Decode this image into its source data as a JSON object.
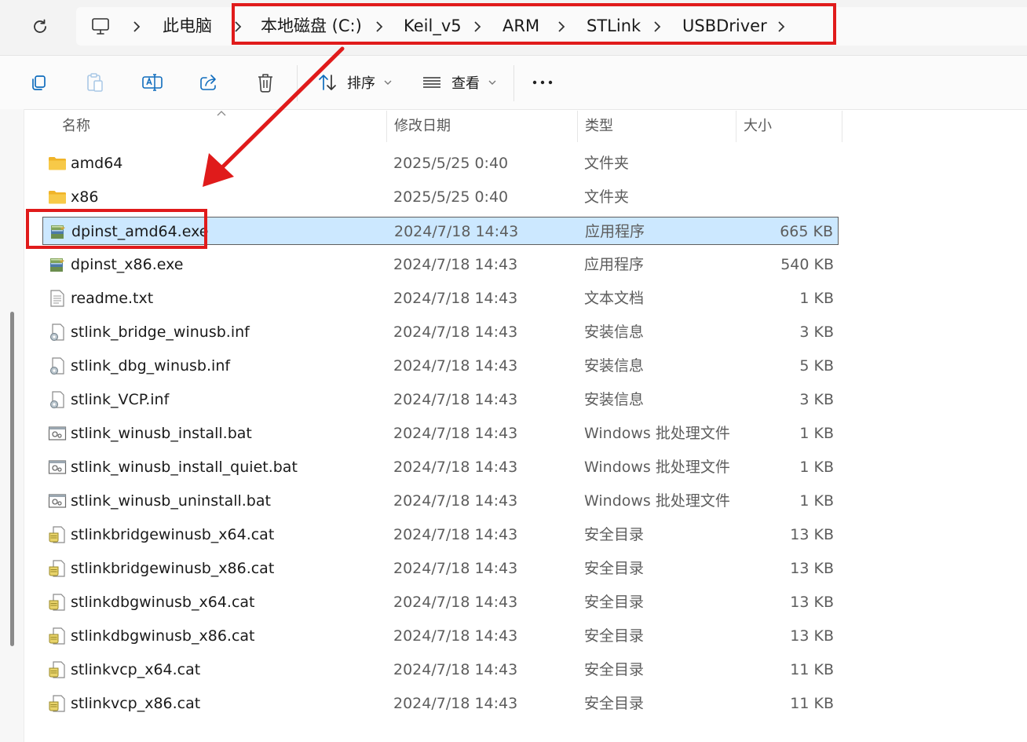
{
  "address": {
    "crumbs": [
      "此电脑",
      "本地磁盘 (C:)",
      "Keil_v5",
      "ARM",
      "STLink",
      "USBDriver"
    ]
  },
  "toolbar": {
    "sort_label": "排序",
    "view_label": "查看"
  },
  "columns": {
    "name": "名称",
    "date": "修改日期",
    "type": "类型",
    "size": "大小"
  },
  "files": [
    {
      "name": "amd64",
      "date": "2025/5/25 0:40",
      "type": "文件夹",
      "size": "",
      "icon": "folder-icon"
    },
    {
      "name": "x86",
      "date": "2025/5/25 0:40",
      "type": "文件夹",
      "size": "",
      "icon": "folder-icon"
    },
    {
      "name": "dpinst_amd64.exe",
      "date": "2024/7/18 14:43",
      "type": "应用程序",
      "size": "665 KB",
      "icon": "installer-icon",
      "selected": true
    },
    {
      "name": "dpinst_x86.exe",
      "date": "2024/7/18 14:43",
      "type": "应用程序",
      "size": "540 KB",
      "icon": "installer-icon"
    },
    {
      "name": "readme.txt",
      "date": "2024/7/18 14:43",
      "type": "文本文档",
      "size": "1 KB",
      "icon": "text-file-icon"
    },
    {
      "name": "stlink_bridge_winusb.inf",
      "date": "2024/7/18 14:43",
      "type": "安装信息",
      "size": "3 KB",
      "icon": "setup-info-icon"
    },
    {
      "name": "stlink_dbg_winusb.inf",
      "date": "2024/7/18 14:43",
      "type": "安装信息",
      "size": "5 KB",
      "icon": "setup-info-icon"
    },
    {
      "name": "stlink_VCP.inf",
      "date": "2024/7/18 14:43",
      "type": "安装信息",
      "size": "3 KB",
      "icon": "setup-info-icon"
    },
    {
      "name": "stlink_winusb_install.bat",
      "date": "2024/7/18 14:43",
      "type": "Windows 批处理文件",
      "size": "1 KB",
      "icon": "batch-file-icon"
    },
    {
      "name": "stlink_winusb_install_quiet.bat",
      "date": "2024/7/18 14:43",
      "type": "Windows 批处理文件",
      "size": "1 KB",
      "icon": "batch-file-icon"
    },
    {
      "name": "stlink_winusb_uninstall.bat",
      "date": "2024/7/18 14:43",
      "type": "Windows 批处理文件",
      "size": "1 KB",
      "icon": "batch-file-icon"
    },
    {
      "name": "stlinkbridgewinusb_x64.cat",
      "date": "2024/7/18 14:43",
      "type": "安全目录",
      "size": "13 KB",
      "icon": "security-catalog-icon"
    },
    {
      "name": "stlinkbridgewinusb_x86.cat",
      "date": "2024/7/18 14:43",
      "type": "安全目录",
      "size": "13 KB",
      "icon": "security-catalog-icon"
    },
    {
      "name": "stlinkdbgwinusb_x64.cat",
      "date": "2024/7/18 14:43",
      "type": "安全目录",
      "size": "13 KB",
      "icon": "security-catalog-icon"
    },
    {
      "name": "stlinkdbgwinusb_x86.cat",
      "date": "2024/7/18 14:43",
      "type": "安全目录",
      "size": "13 KB",
      "icon": "security-catalog-icon"
    },
    {
      "name": "stlinkvcp_x64.cat",
      "date": "2024/7/18 14:43",
      "type": "安全目录",
      "size": "11 KB",
      "icon": "security-catalog-icon"
    },
    {
      "name": "stlinkvcp_x86.cat",
      "date": "2024/7/18 14:43",
      "type": "安全目录",
      "size": "11 KB",
      "icon": "security-catalog-icon"
    }
  ],
  "colors": {
    "annotation": "#e01b1b",
    "selection": "#cce8ff",
    "folder": "#f7c948"
  }
}
